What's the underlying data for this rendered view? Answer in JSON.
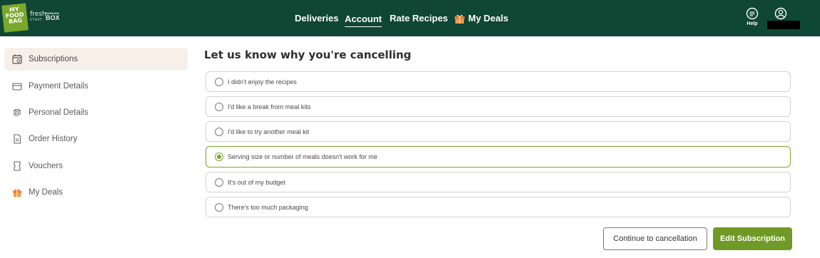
{
  "brand": {
    "logo_text": "MY FOOD BAG",
    "fresh_label": "fresh",
    "fresh_sub": "START",
    "box_sub": "BARGAIN",
    "box_label": "BOX"
  },
  "nav": {
    "deliveries": "Deliveries",
    "account": "Account",
    "rate_recipes": "Rate Recipes",
    "my_deals": "My Deals",
    "help": "Help"
  },
  "sidebar": {
    "items": [
      {
        "label": "Subscriptions",
        "icon": "calendar-icon",
        "active": true
      },
      {
        "label": "Payment Details",
        "icon": "credit-card-icon"
      },
      {
        "label": "Personal Details",
        "icon": "fingerprint-icon"
      },
      {
        "label": "Order History",
        "icon": "document-icon"
      },
      {
        "label": "Vouchers",
        "icon": "voucher-icon"
      },
      {
        "label": "My Deals",
        "icon": "gift-icon"
      }
    ]
  },
  "main": {
    "title": "Let us know why you're cancelling",
    "options": [
      {
        "label": "I didn't enjoy the recipes",
        "selected": false
      },
      {
        "label": "I'd like a break from meal kits",
        "selected": false
      },
      {
        "label": "I'd like to try another meal kit",
        "selected": false
      },
      {
        "label": "Serving size or number of meals doesn't work for me",
        "selected": true
      },
      {
        "label": "It's out of my budget",
        "selected": false
      },
      {
        "label": "There's too much packaging",
        "selected": false
      }
    ],
    "continue_label": "Continue to cancellation",
    "edit_label": "Edit Subscription"
  },
  "colors": {
    "header_bg": "#0f4634",
    "accent_green": "#7aa62c",
    "primary_button": "#6f9a25",
    "active_sidebar_bg": "#f7f0e8"
  }
}
